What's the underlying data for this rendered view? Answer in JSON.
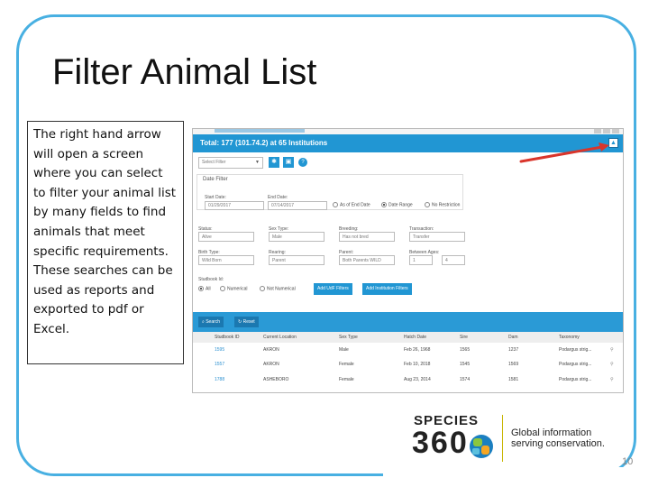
{
  "slide": {
    "title": "Filter Animal List",
    "note": "The right hand arrow will open a screen where you can select to filter your animal list by many fields to find animals that meet specific requirements. These searches can be used as reports and exported to pdf or Excel.",
    "page_number": "10"
  },
  "app": {
    "header_text": "Total: 177 (101.74.2) at 65 Institutions",
    "collapse_icon": "chevron-up-icon",
    "select_filter_placeholder": "Select Filter",
    "date_filter": {
      "title": "Date Filter",
      "start_label": "Start Date:",
      "start_value": "01/29/2017",
      "end_label": "End Date:",
      "end_value": "07/14/2017",
      "options": [
        "As of End Date",
        "Date Range",
        "No Restriction"
      ],
      "selected_option": "Date Range"
    },
    "fields_row1": [
      {
        "label": "Status:",
        "value": "Alive"
      },
      {
        "label": "Sex Type:",
        "value": "Male"
      },
      {
        "label": "Breeding:",
        "value": "Has not bred"
      },
      {
        "label": "Transaction:",
        "value": "Transfer"
      }
    ],
    "fields_row2": [
      {
        "label": "Birth Type:",
        "value": "Wild Born"
      },
      {
        "label": "Rearing:",
        "value": "Parent"
      },
      {
        "label": "Parent:",
        "value": "Both Parents WILD"
      },
      {
        "label": "Between Ages:",
        "value_from": "1",
        "value_to": "4"
      }
    ],
    "studbook_id": {
      "label": "Studbook Id:",
      "options": [
        "All",
        "Numerical",
        "Not Numerical"
      ],
      "selected_option": "All"
    },
    "add_udf_filters": "Add UdF Filters",
    "add_institution_filters": "Add Institution Filters",
    "search_button": "Search",
    "reset_button": "Reset",
    "columns": [
      "Studbook ID",
      "Current Location",
      "Sex Type",
      "Hatch Date",
      "Sire",
      "Dam",
      "Taxonomy"
    ],
    "rows": [
      [
        "1595",
        "AKRON",
        "Male",
        "Feb 26, 1968",
        "1565",
        "1237",
        "Podargus strig..."
      ],
      [
        "1557",
        "AKRON",
        "Female",
        "Feb 10, 2018",
        "1545",
        "1569",
        "Podargus strig..."
      ],
      [
        "1788",
        "ASHEBORO",
        "Female",
        "Aug 23, 2014",
        "1574",
        "1581",
        "Podargus strig..."
      ]
    ]
  },
  "logo": {
    "word": "SPECIES",
    "number": "360",
    "tagline_line1": "Global information",
    "tagline_line2": "serving conservation."
  },
  "colors": {
    "frame": "#48b0e2",
    "app_blue": "#2196d3",
    "arrow": "#d9352b"
  }
}
